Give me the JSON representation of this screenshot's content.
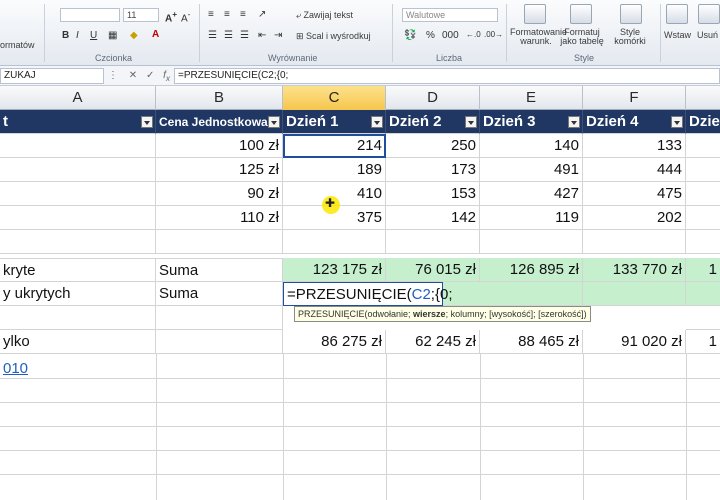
{
  "ribbon": {
    "format_label": "ormatów",
    "font_size": "11",
    "font_group": "Czcionka",
    "wrap_text": "Zawijaj tekst",
    "merge_center": "Scal i wyśrodkuj",
    "align_group": "Wyrównanie",
    "number_format": "Walutowe",
    "number_group": "Liczba",
    "cond_format": "Formatowanie warunk.",
    "format_table": "Formatuj jako tabelę",
    "cell_styles": "Style komórki",
    "styles_group": "Style",
    "insert": "Wstaw",
    "delete": "Usuń"
  },
  "formula_bar": {
    "name_box": "ZUKAJ",
    "formula": "=PRZESUNIĘCIE(C2;{0;"
  },
  "columns": [
    "A",
    "B",
    "C",
    "D",
    "E",
    "F"
  ],
  "header_row": {
    "a": "t",
    "b": "Cena Jednostkowa",
    "c": "Dzień 1",
    "d": "Dzień 2",
    "e": "Dzień 3",
    "f": "Dzień 4",
    "g": "Dzie"
  },
  "data_rows": [
    {
      "b": "100 zł",
      "c": "214",
      "d": "250",
      "e": "140",
      "f": "133"
    },
    {
      "b": "125 zł",
      "c": "189",
      "d": "173",
      "e": "491",
      "f": "444"
    },
    {
      "b": "90 zł",
      "c": "410",
      "d": "153",
      "e": "427",
      "f": "475"
    },
    {
      "b": "110 zł",
      "c": "375",
      "d": "142",
      "e": "119",
      "f": "202"
    }
  ],
  "sum_visible_row": {
    "a": "kryte",
    "b": "Suma",
    "c": "123 175 zł",
    "d": "76 015 zł",
    "e": "126 895 zł",
    "f": "133 770 zł",
    "g": "1"
  },
  "sum_hidden_row": {
    "a": "y ukrytych",
    "b": "Suma",
    "c_formula": "=PRZESUNIĘCIE(",
    "c_ref": "C2",
    "c_rest": ";{0;"
  },
  "tooltip": {
    "pre": "PRZESUNIĘCIE(odwołanie; ",
    "bold": "wiersze",
    "post": "; kolumny; [wysokość]; [szerokość])"
  },
  "total_row": {
    "a": "ylko",
    "c": "86 275 zł",
    "d": "62 245 zł",
    "e": "88 465 zł",
    "f": "91 020 zł",
    "g": "1"
  },
  "link_text": "010",
  "colors": {
    "header_bg": "#203764",
    "sum_fill": "#c6efce",
    "active_col": "#f6c64d"
  }
}
